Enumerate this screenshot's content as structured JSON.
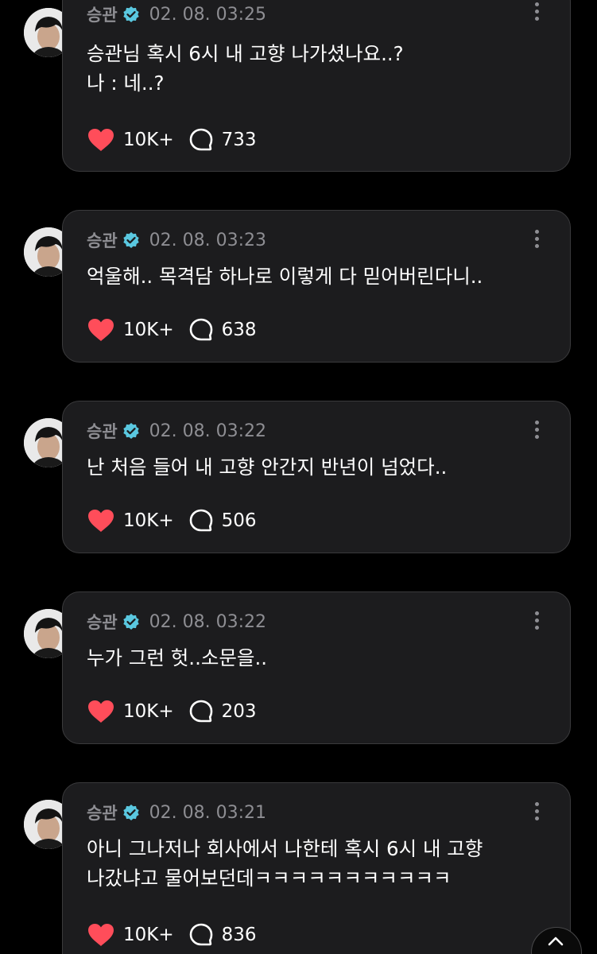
{
  "colors": {
    "background": "#000000",
    "card": "#1c1c1e",
    "card_border": "#3a3a3c",
    "muted_text": "#8e8e93",
    "verified": "#5ac8e0",
    "heart": "#ff4d5a"
  },
  "posts": [
    {
      "author": "승관",
      "timestamp": "02. 08. 03:25",
      "text": "승관님 혹시 6시 내 고향 나가셨나요..?\n나 : 네..?",
      "likes": "10K+",
      "replies": "733"
    },
    {
      "author": "승관",
      "timestamp": "02. 08. 03:23",
      "text": "억울해.. 목격담 하나로 이렇게 다 믿어버린다니..",
      "likes": "10K+",
      "replies": "638"
    },
    {
      "author": "승관",
      "timestamp": "02. 08. 03:22",
      "text": "난 처음 들어 내 고향 안간지 반년이 넘었다..",
      "likes": "10K+",
      "replies": "506"
    },
    {
      "author": "승관",
      "timestamp": "02. 08. 03:22",
      "text": "누가 그런 헛..소문을..",
      "likes": "10K+",
      "replies": "203"
    },
    {
      "author": "승관",
      "timestamp": "02. 08. 03:21",
      "text": "아니 그나저나 회사에서 나한테 혹시 6시 내 고향\n나갔냐고 물어보던데ㅋㅋㅋㅋㅋㅋㅋㅋㅋㅋㅋ",
      "likes": "10K+",
      "replies": "836"
    }
  ]
}
